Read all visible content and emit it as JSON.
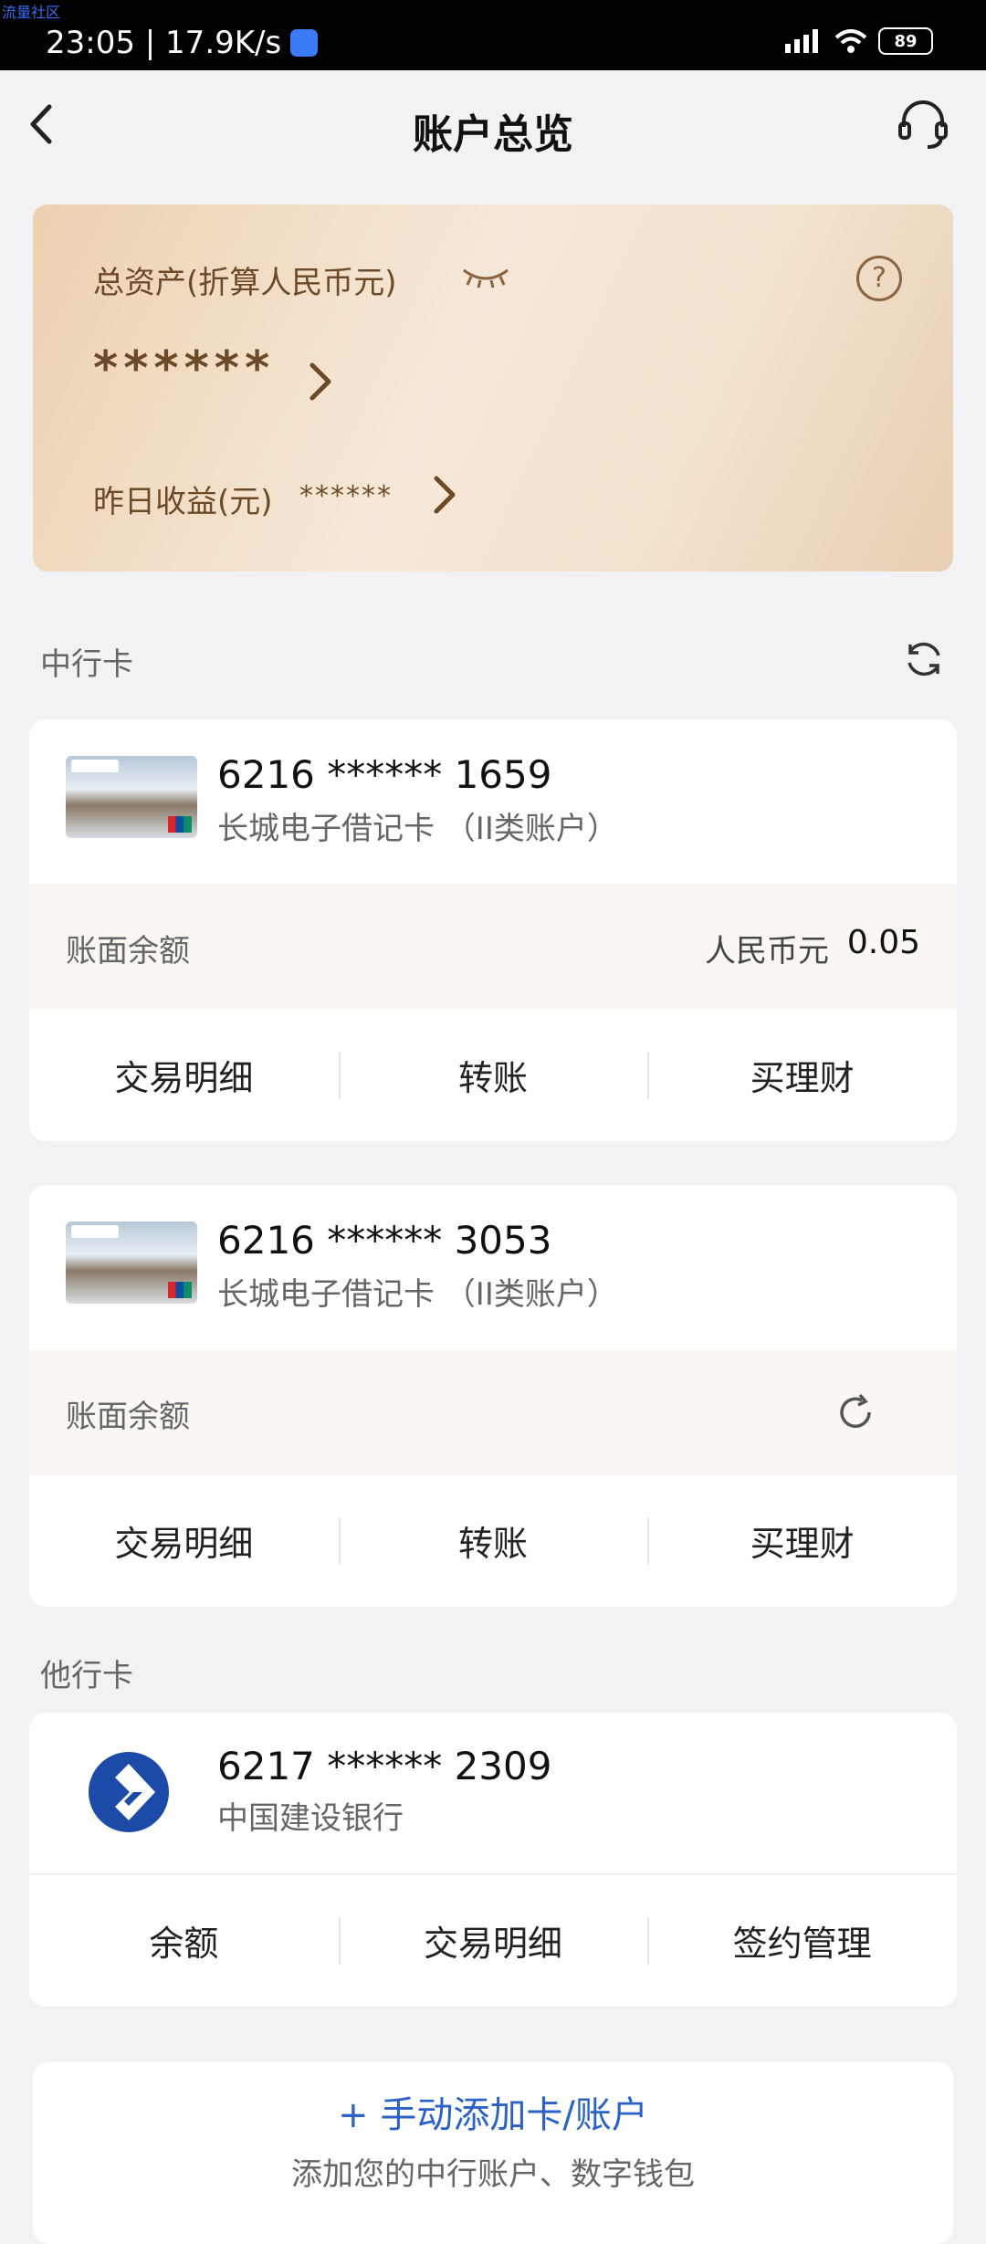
{
  "status_bar": {
    "watermark": "流量社区",
    "time_speed": "23:05 | 17.9K/s",
    "battery": "89"
  },
  "header": {
    "title": "账户总览"
  },
  "assets": {
    "label": "总资产(折算人民币元)",
    "help": "?",
    "total_masked": "******",
    "yesterday_label": "昨日收益(元)",
    "yesterday_masked": "******"
  },
  "boc_section": {
    "label": "中行卡",
    "cards": [
      {
        "number": "6216 ****** 1659",
        "type": "长城电子借记卡 （II类账户）",
        "balance_label": "账面余额",
        "currency": "人民币元",
        "amount": "0.05",
        "actions": [
          "交易明细",
          "转账",
          "买理财"
        ]
      },
      {
        "number": "6216 ****** 3053",
        "type": "长城电子借记卡 （II类账户）",
        "balance_label": "账面余额",
        "actions": [
          "交易明细",
          "转账",
          "买理财"
        ]
      }
    ]
  },
  "other_section": {
    "label": "他行卡",
    "card": {
      "number": "6217 ****** 2309",
      "bank": "中国建设银行",
      "actions": [
        "余额",
        "交易明细",
        "签约管理"
      ]
    }
  },
  "add": {
    "title": "+ 手动添加卡/账户",
    "subtitle": "添加您的中行账户、数字钱包"
  },
  "colors": {
    "accent_gold": "#6d4a27",
    "link_blue": "#2c62c8",
    "ccb_blue": "#1c4aa8"
  }
}
